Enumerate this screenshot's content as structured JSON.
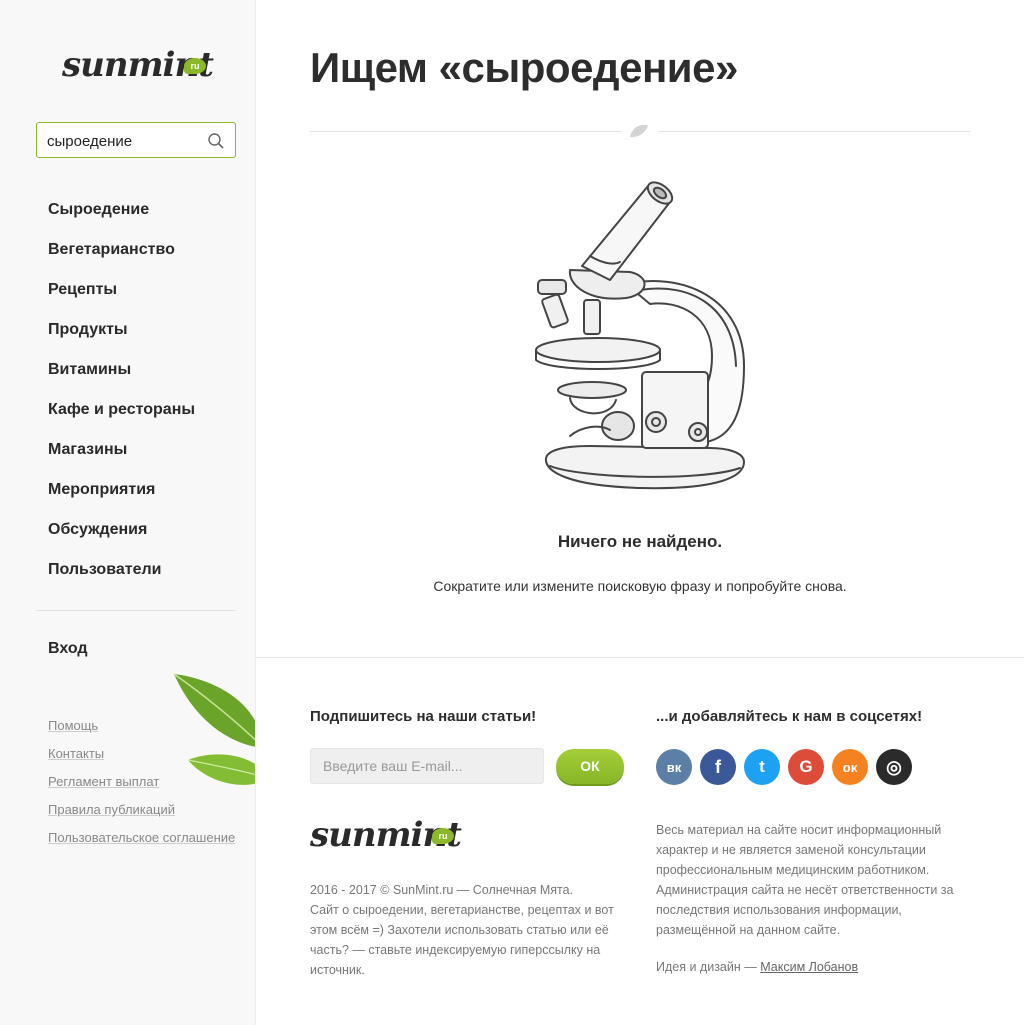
{
  "sidebar": {
    "logo_text": "sunmint",
    "logo_badge": "ru",
    "search": {
      "value": "сыроедение",
      "placeholder": ""
    },
    "nav": [
      "Сыроедение",
      "Вегетарианство",
      "Рецепты",
      "Продукты",
      "Витамины",
      "Кафе и рестораны",
      "Магазины",
      "Мероприятия",
      "Обсуждения",
      "Пользователи"
    ],
    "login": "Вход",
    "links": [
      "Помощь",
      "Контакты",
      "Регламент выплат",
      "Правила публикаций",
      "Пользовательское соглашение"
    ]
  },
  "main": {
    "title": "Ищем «сыроедение»",
    "not_found": "Ничего не найдено.",
    "hint": "Сократите или измените поисковую фразу и попробуйте снова."
  },
  "footer": {
    "subscribe_title": "Подпишитесь на наши статьи!",
    "email_placeholder": "Введите ваш E-mail...",
    "ok_label": "ОК",
    "logo_text": "sunmint",
    "logo_badge": "ru",
    "copy_line1": "2016 - 2017 © SunMint.ru — Солнечная Мята.",
    "copy_line2": "Сайт о сыроедении, вегетарианстве, рецептах и вот этом всём =) Захотели использовать статью или её часть? — ставьте индексируемую гиперссылку на источник.",
    "social_title": "...и добавляйтесь к нам в соцсетях!",
    "socials": [
      {
        "name": "vk-icon",
        "glyph": "вк",
        "color": "#5b7fa6"
      },
      {
        "name": "facebook-icon",
        "glyph": "f",
        "color": "#3b5998"
      },
      {
        "name": "twitter-icon",
        "glyph": "t",
        "color": "#1da1f2"
      },
      {
        "name": "google-icon",
        "glyph": "G",
        "color": "#dd4b39"
      },
      {
        "name": "odnoklassniki-icon",
        "glyph": "ок",
        "color": "#f58220"
      },
      {
        "name": "instagram-icon",
        "glyph": "◎",
        "color": "#2b2b2b"
      }
    ],
    "disclaimer": "Весь материал на сайте носит информационный характер и не является заменой консультации профессиональным медицинским работником. Администрация сайта не несёт ответственности за последствия использования информации, размещённой на данном сайте.",
    "credit_prefix": "Идея и дизайн — ",
    "credit_name": "Максим Лобанов"
  },
  "colors": {
    "accent": "#8cb82b",
    "text": "#2d2d2d",
    "muted": "#777777"
  }
}
